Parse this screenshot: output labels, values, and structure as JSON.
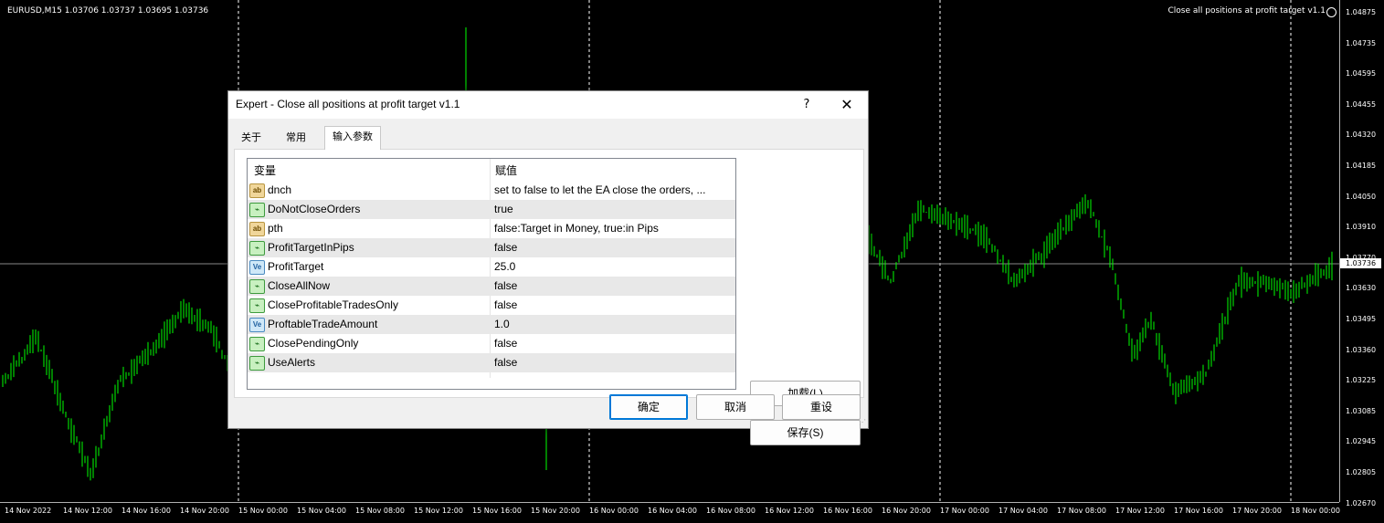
{
  "chart": {
    "symbol_info": "EURUSD,M15  1.03706 1.03737 1.03695 1.03736",
    "ea_label": "Close all positions at profit target v1.1",
    "current_price": "1.03736",
    "price_ticks": [
      "1.04875",
      "1.04735",
      "1.04595",
      "1.04455",
      "1.04320",
      "1.04185",
      "1.04050",
      "1.03910",
      "1.03770",
      "1.03630",
      "1.03495",
      "1.03360",
      "1.03225",
      "1.03085",
      "1.02945",
      "1.02805",
      "1.02670"
    ],
    "time_ticks": [
      "14 Nov 2022",
      "14 Nov 12:00",
      "14 Nov 16:00",
      "14 Nov 20:00",
      "15 Nov 00:00",
      "15 Nov 04:00",
      "15 Nov 08:00",
      "15 Nov 12:00",
      "15 Nov 16:00",
      "15 Nov 20:00",
      "16 Nov 00:00",
      "16 Nov 04:00",
      "16 Nov 08:00",
      "16 Nov 12:00",
      "16 Nov 16:00",
      "16 Nov 20:00",
      "17 Nov 00:00",
      "17 Nov 04:00",
      "17 Nov 08:00",
      "17 Nov 12:00",
      "17 Nov 16:00",
      "17 Nov 20:00",
      "18 Nov 00:00"
    ],
    "colors": {
      "background": "#000000",
      "candles": "#00ff00",
      "grid": "#ffffff"
    }
  },
  "dialog": {
    "title": "Expert - Close all positions at profit target v1.1",
    "help": "?",
    "close": "✕",
    "tabs": {
      "about": "关于",
      "common": "常用",
      "inputs": "输入参数"
    },
    "columns": {
      "variable": "变量",
      "value": "赋值"
    },
    "params": [
      {
        "name": "dnch",
        "value": "set to false to let the EA close the orders, ...",
        "type": "ab"
      },
      {
        "name": "DoNotCloseOrders",
        "value": "true",
        "type": "bool"
      },
      {
        "name": "pth",
        "value": "false:Target in Money, true:in Pips",
        "type": "ab"
      },
      {
        "name": "ProfitTargetInPips",
        "value": "false",
        "type": "bool"
      },
      {
        "name": "ProfitTarget",
        "value": "25.0",
        "type": "val"
      },
      {
        "name": "CloseAllNow",
        "value": "false",
        "type": "bool"
      },
      {
        "name": "CloseProfitableTradesOnly",
        "value": "false",
        "type": "bool"
      },
      {
        "name": "ProftableTradeAmount",
        "value": "1.0",
        "type": "val"
      },
      {
        "name": "ClosePendingOnly",
        "value": "false",
        "type": "bool"
      },
      {
        "name": "UseAlerts",
        "value": "false",
        "type": "bool"
      }
    ],
    "icon_text": {
      "ab": "ab",
      "bool": "⌁",
      "val": "Ve"
    },
    "buttons": {
      "load": "加载(L)",
      "save": "保存(S)",
      "ok": "确定",
      "cancel": "取消",
      "reset": "重设"
    }
  }
}
